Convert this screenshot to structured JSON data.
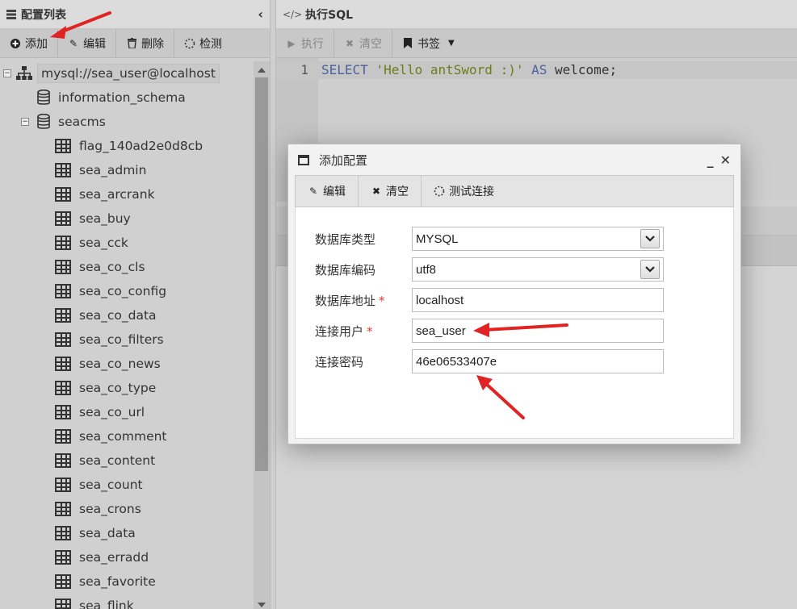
{
  "left_panel": {
    "title": "配置列表",
    "toolbar": {
      "add": "添加",
      "edit": "编辑",
      "delete": "删除",
      "check": "检测"
    },
    "tree": {
      "root": "mysql://sea_user@localhost",
      "databases": [
        "information_schema",
        "seacms"
      ],
      "tables": [
        "flag_140ad2e0d8cb",
        "sea_admin",
        "sea_arcrank",
        "sea_buy",
        "sea_cck",
        "sea_co_cls",
        "sea_co_config",
        "sea_co_data",
        "sea_co_filters",
        "sea_co_news",
        "sea_co_type",
        "sea_co_url",
        "sea_comment",
        "sea_content",
        "sea_count",
        "sea_crons",
        "sea_data",
        "sea_erradd",
        "sea_favorite",
        "sea_flink"
      ]
    }
  },
  "right_panel": {
    "title": "执行SQL",
    "toolbar": {
      "run": "执行",
      "clear": "清空",
      "bookmark": "书签"
    },
    "editor": {
      "line_number": "1",
      "kw1": "SELECT",
      "str": "'Hello antSword :)'",
      "kw2": "AS",
      "ident": "welcome;"
    }
  },
  "dialog": {
    "title": "添加配置",
    "toolbar": {
      "edit": "编辑",
      "clear": "清空",
      "test": "测试连接"
    },
    "fields": {
      "db_type": {
        "label": "数据库类型",
        "value": "MYSQL"
      },
      "db_encoding": {
        "label": "数据库编码",
        "value": "utf8"
      },
      "db_host": {
        "label": "数据库地址",
        "value": "localhost",
        "required": "*"
      },
      "db_user": {
        "label": "连接用户",
        "value": "sea_user",
        "required": "*"
      },
      "db_password": {
        "label": "连接密码",
        "value": "46e06533407e"
      }
    }
  },
  "colors": {
    "annotation_arrow": "#e02424",
    "required_star": "#e53935"
  }
}
